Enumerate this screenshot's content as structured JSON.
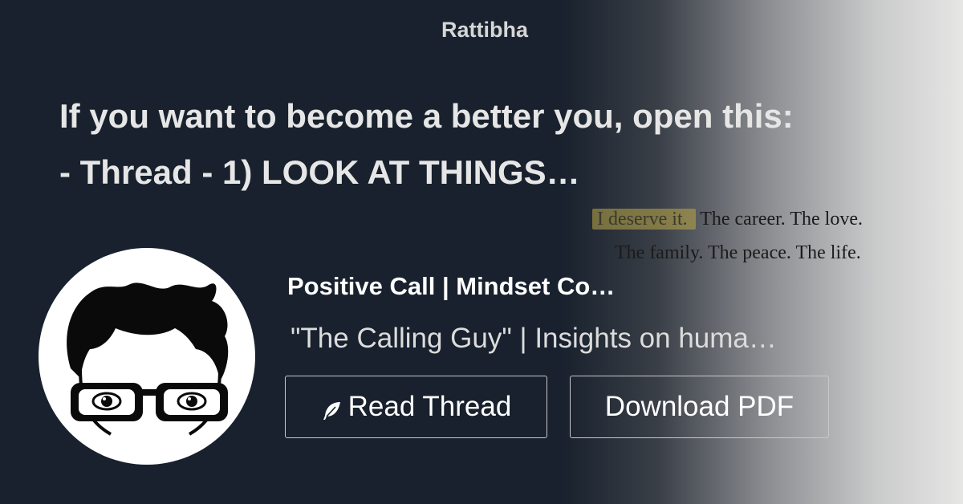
{
  "brand": "Rattibha",
  "thread": {
    "title_line1": "If you want to become a better you, open this:",
    "title_line2": "- Thread - 1) LOOK AT THINGS…"
  },
  "background_quote": {
    "highlight": "I deserve it.",
    "rest_line1": "The career. The love.",
    "line2": "The family. The peace. The life."
  },
  "author": {
    "name": "Positive Call | Mindset Co…",
    "bio": "\"The Calling Guy\" | Insights on huma…"
  },
  "actions": {
    "read_label": "Read Thread",
    "read_icon": "feather-icon",
    "download_label": "Download PDF"
  },
  "colors": {
    "background": "#18212d",
    "text": "#e6e6e6",
    "button_border": "#c8c8c8"
  }
}
